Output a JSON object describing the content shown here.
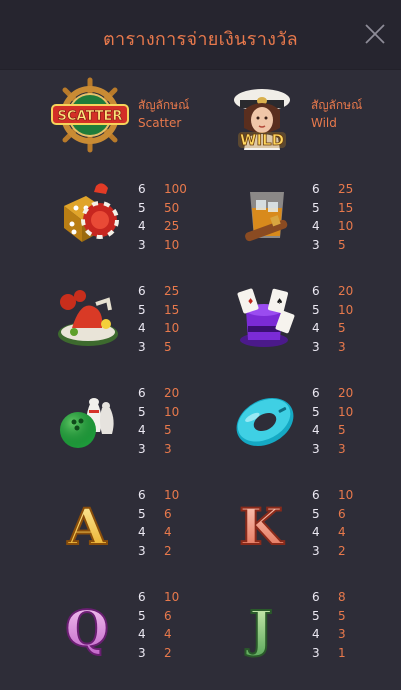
{
  "header": {
    "title": "ตารางการจ่ายเงินรางวัล"
  },
  "specials": [
    {
      "name": "scatter",
      "label_th": "สัญลักษณ์",
      "label_en": "Scatter",
      "logo_text": "SCATTER"
    },
    {
      "name": "wild",
      "label_th": "สัญลักษณ์",
      "label_en": "Wild",
      "logo_text": "WILD"
    }
  ],
  "paytable": [
    {
      "symbol": "dice-chip",
      "rows": [
        [
          "6",
          "100"
        ],
        [
          "5",
          "50"
        ],
        [
          "4",
          "25"
        ],
        [
          "3",
          "10"
        ]
      ]
    },
    {
      "symbol": "whiskey-cigar",
      "rows": [
        [
          "6",
          "25"
        ],
        [
          "5",
          "15"
        ],
        [
          "4",
          "10"
        ],
        [
          "3",
          "5"
        ]
      ]
    },
    {
      "symbol": "lobster-plate",
      "rows": [
        [
          "6",
          "25"
        ],
        [
          "5",
          "15"
        ],
        [
          "4",
          "10"
        ],
        [
          "3",
          "5"
        ]
      ]
    },
    {
      "symbol": "magic-hat-cards",
      "rows": [
        [
          "6",
          "20"
        ],
        [
          "5",
          "10"
        ],
        [
          "4",
          "5"
        ],
        [
          "3",
          "3"
        ]
      ]
    },
    {
      "symbol": "bowling",
      "rows": [
        [
          "6",
          "20"
        ],
        [
          "5",
          "10"
        ],
        [
          "4",
          "5"
        ],
        [
          "3",
          "3"
        ]
      ]
    },
    {
      "symbol": "swim-ring",
      "rows": [
        [
          "6",
          "20"
        ],
        [
          "5",
          "10"
        ],
        [
          "4",
          "5"
        ],
        [
          "3",
          "3"
        ]
      ]
    },
    {
      "symbol": "letter-a",
      "letter": "A",
      "rows": [
        [
          "6",
          "10"
        ],
        [
          "5",
          "6"
        ],
        [
          "4",
          "4"
        ],
        [
          "3",
          "2"
        ]
      ]
    },
    {
      "symbol": "letter-k",
      "letter": "K",
      "rows": [
        [
          "6",
          "10"
        ],
        [
          "5",
          "6"
        ],
        [
          "4",
          "4"
        ],
        [
          "3",
          "2"
        ]
      ]
    },
    {
      "symbol": "letter-q",
      "letter": "Q",
      "rows": [
        [
          "6",
          "10"
        ],
        [
          "5",
          "6"
        ],
        [
          "4",
          "4"
        ],
        [
          "3",
          "2"
        ]
      ]
    },
    {
      "symbol": "letter-j",
      "letter": "J",
      "rows": [
        [
          "6",
          "8"
        ],
        [
          "5",
          "5"
        ],
        [
          "4",
          "3"
        ],
        [
          "3",
          "1"
        ]
      ]
    }
  ]
}
